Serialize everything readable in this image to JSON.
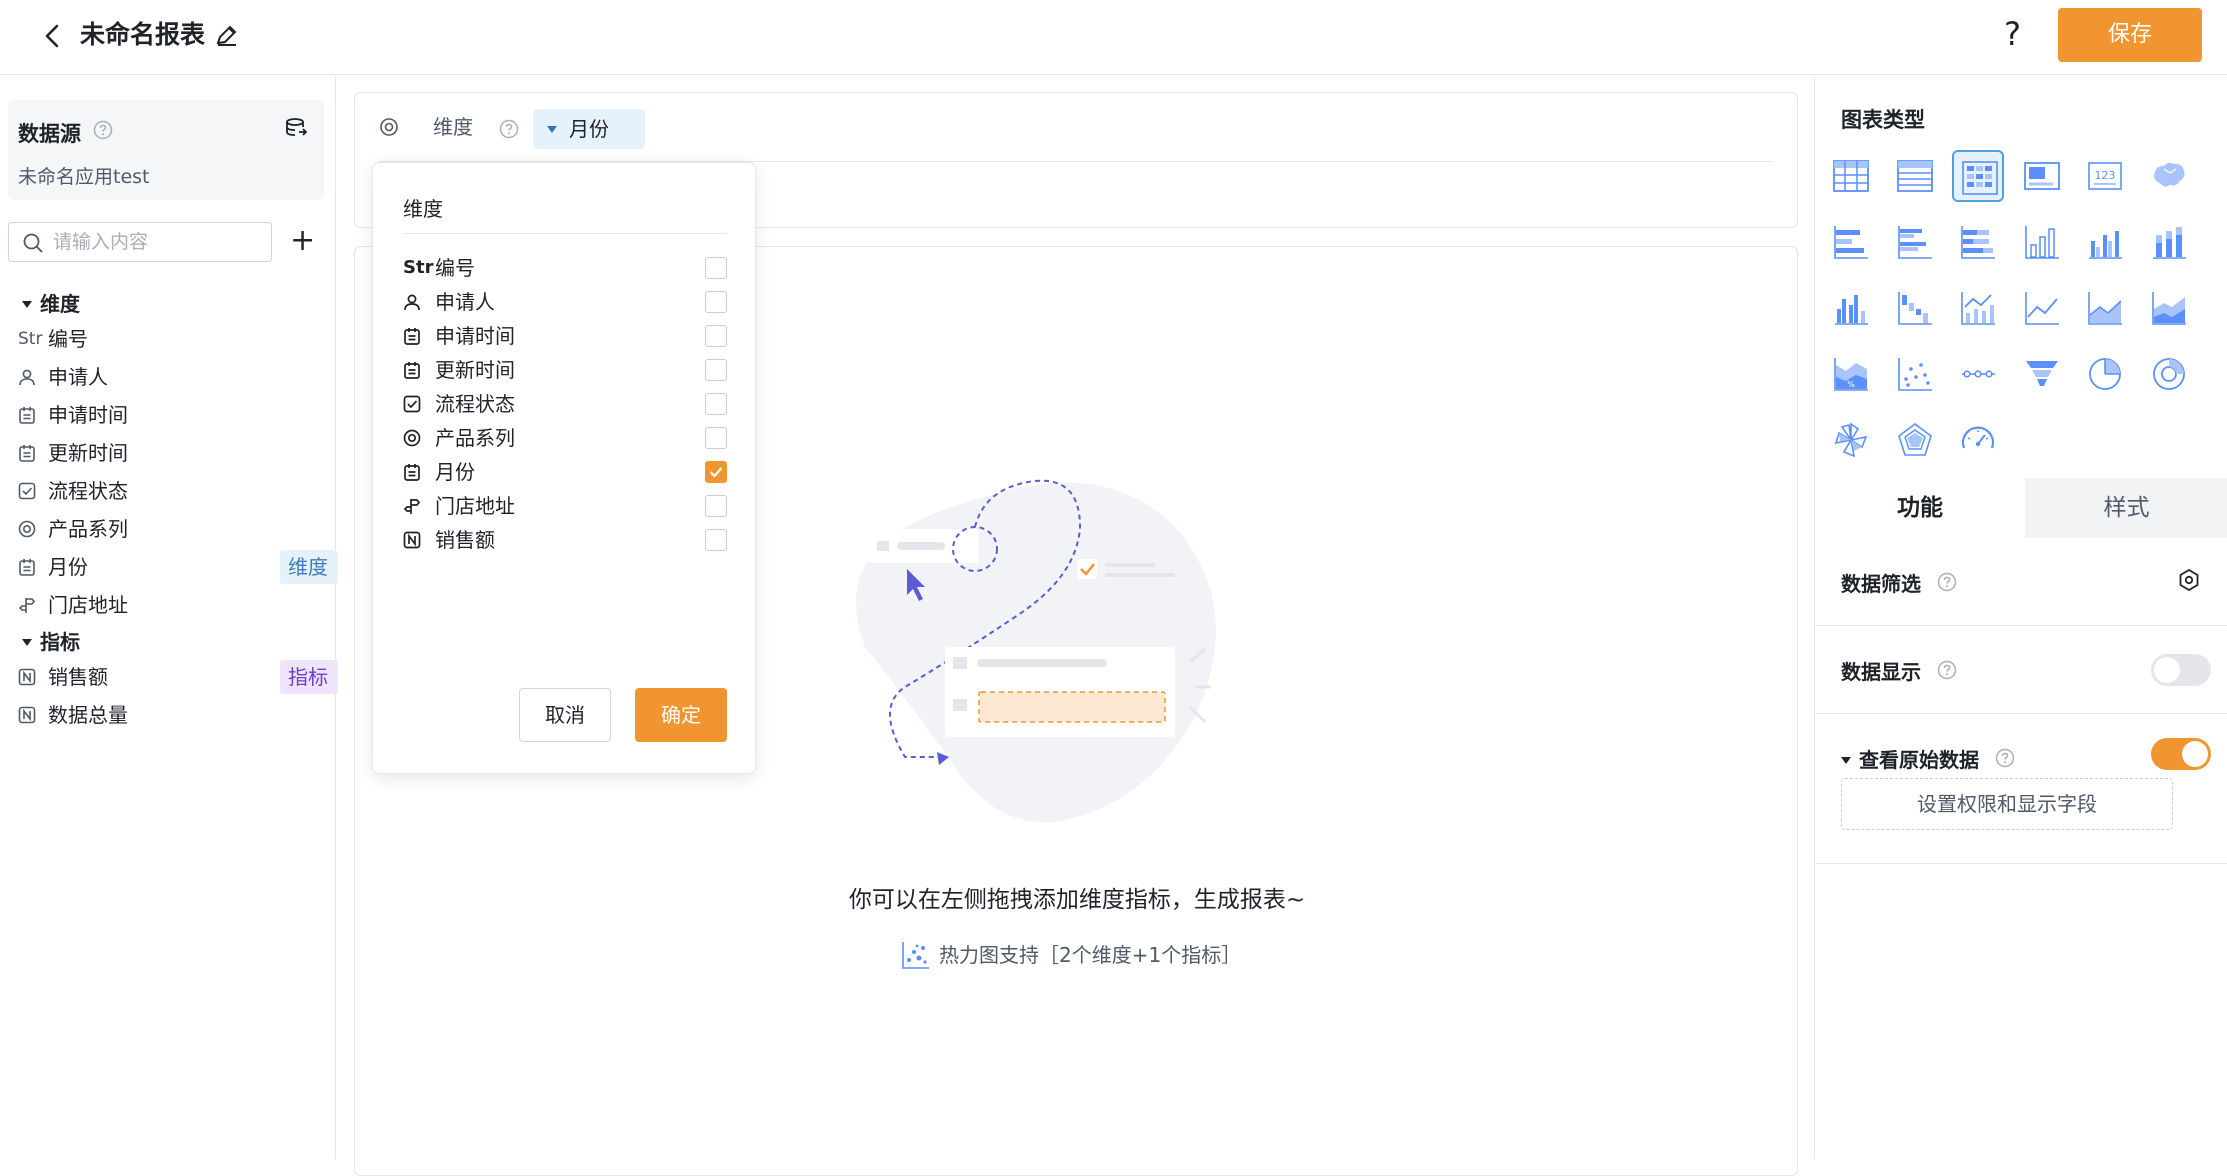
{
  "header": {
    "title": "未命名报表",
    "help_label": "?",
    "save_label": "保存"
  },
  "datasource": {
    "title": "数据源",
    "name": "未命名应用test"
  },
  "search": {
    "placeholder": "请输入内容"
  },
  "sidebar": {
    "dimensions_title": "维度",
    "measures_title": "指标",
    "dimensions": [
      {
        "label": "编号",
        "type": "Str",
        "icon": "str-text-icon"
      },
      {
        "label": "申请人",
        "icon": "person-icon"
      },
      {
        "label": "申请时间",
        "icon": "calendar-icon"
      },
      {
        "label": "更新时间",
        "icon": "calendar-icon"
      },
      {
        "label": "流程状态",
        "icon": "checkbox-icon"
      },
      {
        "label": "产品系列",
        "icon": "radio-icon"
      },
      {
        "label": "月份",
        "icon": "calendar-icon",
        "tag": "维度"
      },
      {
        "label": "门店地址",
        "icon": "location-icon"
      }
    ],
    "measures": [
      {
        "label": "销售额",
        "icon": "number-icon",
        "tag": "指标"
      },
      {
        "label": "数据总量",
        "icon": "number-icon"
      }
    ]
  },
  "center": {
    "dimension_label": "维度",
    "selected_dimension": "月份",
    "empty_message": "你可以在左侧拖拽添加维度指标，生成报表~",
    "hint": "热力图支持［2个维度+1个指标］"
  },
  "dropdown": {
    "title": "维度",
    "items": [
      {
        "label": "编号",
        "type": "Str",
        "checked": false
      },
      {
        "label": "申请人",
        "icon": "person-icon",
        "checked": false
      },
      {
        "label": "申请时间",
        "icon": "calendar-icon",
        "checked": false
      },
      {
        "label": "更新时间",
        "icon": "calendar-icon",
        "checked": false
      },
      {
        "label": "流程状态",
        "icon": "checkbox-icon",
        "checked": false
      },
      {
        "label": "产品系列",
        "icon": "radio-icon",
        "checked": false
      },
      {
        "label": "月份",
        "icon": "calendar-icon",
        "checked": true
      },
      {
        "label": "门店地址",
        "icon": "location-icon",
        "checked": false
      },
      {
        "label": "销售额",
        "icon": "number-icon",
        "checked": false
      }
    ],
    "cancel_label": "取消",
    "ok_label": "确定"
  },
  "right": {
    "chart_types_title": "图表类型",
    "chart_types": [
      "table",
      "detail-table",
      "heatmap",
      "indicator-card",
      "number-card",
      "map",
      "bar-horizontal",
      "bar-horizontal-grouped",
      "bar-horizontal-stacked",
      "column",
      "column-grouped",
      "column-stacked",
      "column-multi",
      "waterfall",
      "line-column",
      "line",
      "area",
      "area-stacked",
      "area-percent",
      "scatter",
      "timeline",
      "funnel",
      "pie",
      "donut",
      "rose",
      "radar",
      "gauge"
    ],
    "selected_chart_type": "heatmap",
    "tabs": {
      "function": "功能",
      "style": "样式"
    },
    "data_filter_label": "数据筛选",
    "data_display_label": "数据显示",
    "data_display_on": false,
    "raw_data_label": "查看原始数据",
    "raw_data_on": true,
    "permission_button": "设置权限和显示字段"
  },
  "colors": {
    "accent": "#f0952f",
    "chart_icon": "#5b8ff9",
    "dimension_tag_bg": "#e6f2fb",
    "measure_tag_bg": "#eee4fb"
  }
}
